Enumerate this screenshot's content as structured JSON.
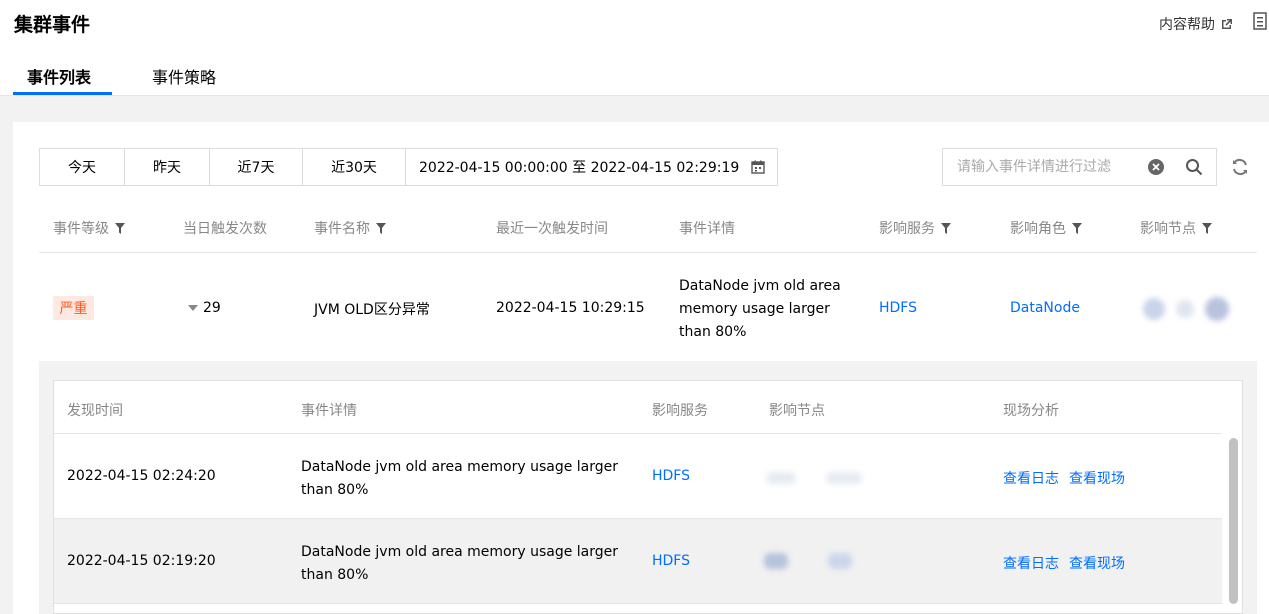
{
  "header": {
    "title": "集群事件",
    "help_label": "内容帮助",
    "tabs": [
      {
        "label": "事件列表",
        "active": true
      },
      {
        "label": "事件策略",
        "active": false
      }
    ]
  },
  "toolbar": {
    "date_buttons": [
      "今天",
      "昨天",
      "近7天",
      "近30天"
    ],
    "date_range": "2022-04-15 00:00:00 至 2022-04-15 02:29:19",
    "search_placeholder": "请输入事件详情进行过滤"
  },
  "table": {
    "columns": [
      "事件等级",
      "当日触发次数",
      "事件名称",
      "最近一次触发时间",
      "事件详情",
      "影响服务",
      "影响角色",
      "影响节点"
    ],
    "row": {
      "level": "严重",
      "count": "29",
      "name": "JVM OLD区分异常",
      "last_time": "2022-04-15 10:29:15",
      "detail_lines": [
        "DataNode jvm old area",
        "memory usage larger",
        "than 80%"
      ],
      "service": "HDFS",
      "role": "DataNode"
    }
  },
  "detail_table": {
    "columns": [
      "发现时间",
      "事件详情",
      "影响服务",
      "影响节点",
      "现场分析"
    ],
    "rows": [
      {
        "time": "2022-04-15 02:24:20",
        "detail_lines": [
          "DataNode jvm old area memory usage larger",
          "than 80%"
        ],
        "service": "HDFS",
        "action_log": "查看日志",
        "action_scene": "查看现场"
      },
      {
        "time": "2022-04-15 02:19:20",
        "detail_lines": [
          "DataNode jvm old area memory usage larger",
          "than 80%"
        ],
        "service": "HDFS",
        "action_log": "查看日志",
        "action_scene": "查看现场"
      }
    ]
  },
  "colors": {
    "accent": "#006eff",
    "severity_text": "#ff5a1f",
    "severity_bg": "#fde9e2"
  }
}
